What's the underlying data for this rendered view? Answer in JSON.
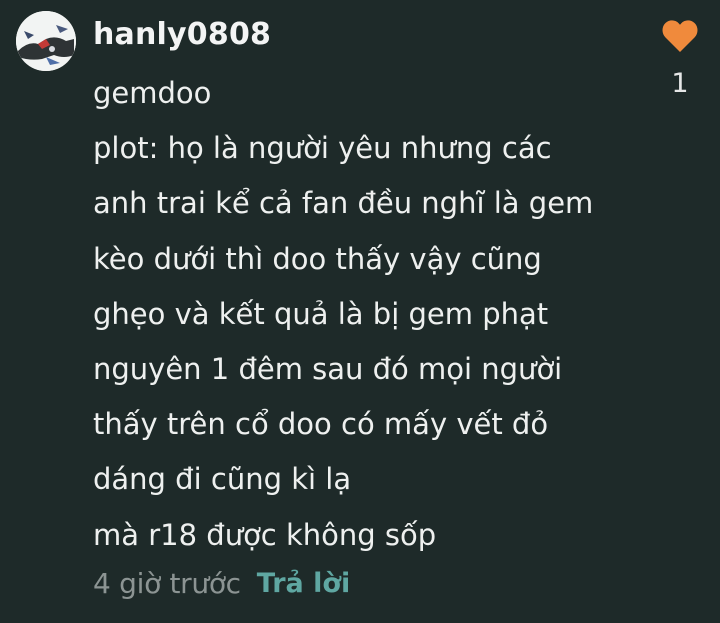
{
  "comment": {
    "username": "hanly0808",
    "avatar_icon": "avatar",
    "like_icon": "heart-icon",
    "like_color": "#f08a3c",
    "like_count": "1",
    "lines": [
      "gemdoo",
      "plot: họ là người yêu nhưng các",
      "anh trai kể cả fan đều nghĩ là gem",
      "kèo dưới thì doo thấy vậy cũng",
      "ghẹo và kết quả là bị gem phạt",
      "nguyên 1 đêm sau đó mọi người",
      "thấy trên cổ doo có mấy vết đỏ",
      "dáng đi cũng kì lạ",
      "mà r18 được không sốp"
    ],
    "time": "4 giờ trước",
    "reply_label": "Trả lời"
  },
  "colors": {
    "background": "#1e2a29",
    "text": "#eef0ef",
    "muted": "#8c9493",
    "accent": "#5fa7a2"
  }
}
